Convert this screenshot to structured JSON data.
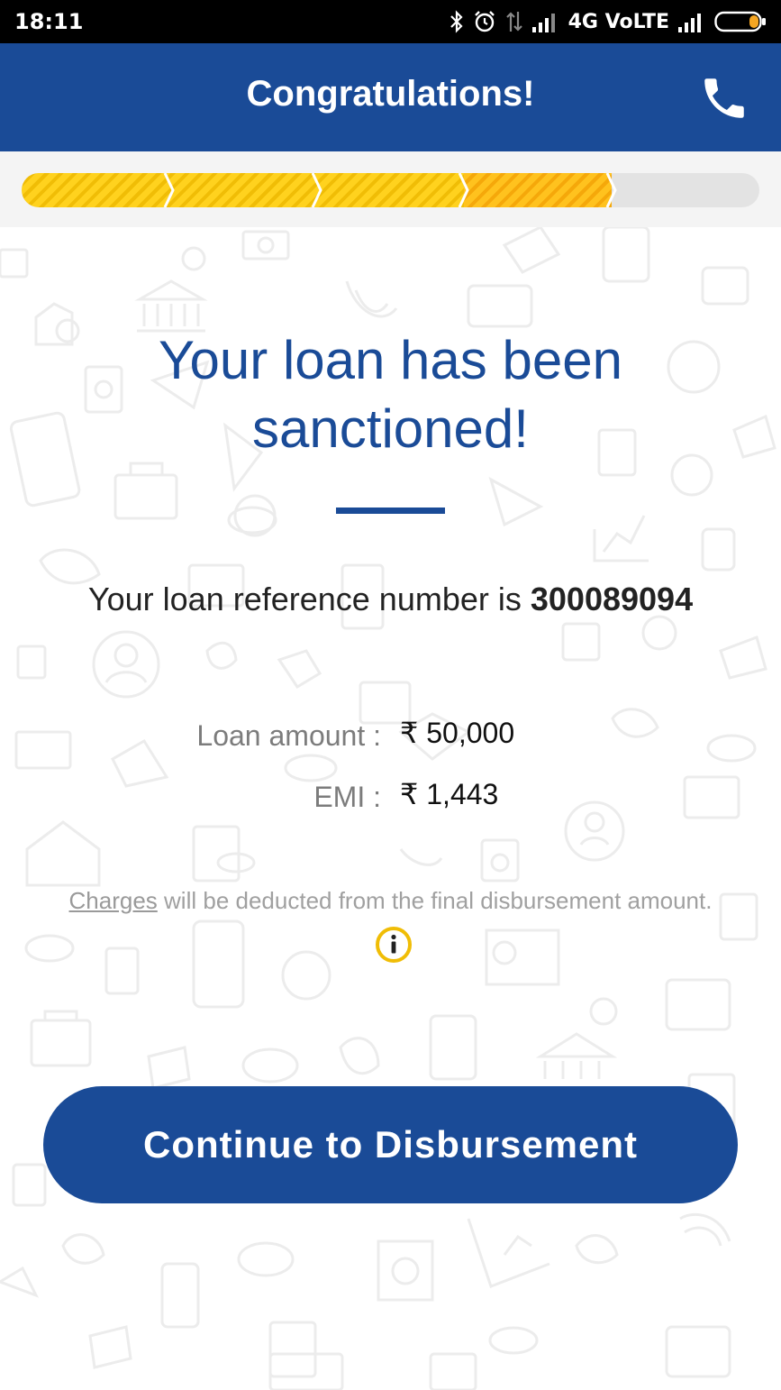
{
  "status_bar": {
    "time": "18:11",
    "network": "4G VoLTE",
    "icons": [
      "bluetooth-icon",
      "alarm-icon",
      "data-arrows-icon",
      "signal-icon",
      "signal-icon",
      "battery-icon"
    ]
  },
  "header": {
    "title": "Congratulations!",
    "call_icon": "phone-icon",
    "background": "#1a4b97"
  },
  "progress": {
    "total_steps": 5,
    "completed_steps": 4,
    "colors": {
      "done": "#ffd21e",
      "current": "#ffbb1e",
      "pending": "#e3e3e3"
    }
  },
  "main": {
    "heading": "Your loan has been sanctioned!",
    "reference_prefix": "Your loan reference number is",
    "reference_number": "300089094",
    "loan_amount_label": "Loan amount :",
    "loan_amount_value": "₹ 50,000",
    "emi_label": "EMI :",
    "emi_value": "₹ 1,443",
    "charges_link": "Charges",
    "charges_text": "will be deducted from the final disbursement amount.",
    "info_icon": "info-icon"
  },
  "cta": {
    "label": "Continue to Disbursement"
  },
  "colors": {
    "primary": "#1a4b97",
    "accent": "#ffd21e",
    "info": "#f0bd06"
  }
}
